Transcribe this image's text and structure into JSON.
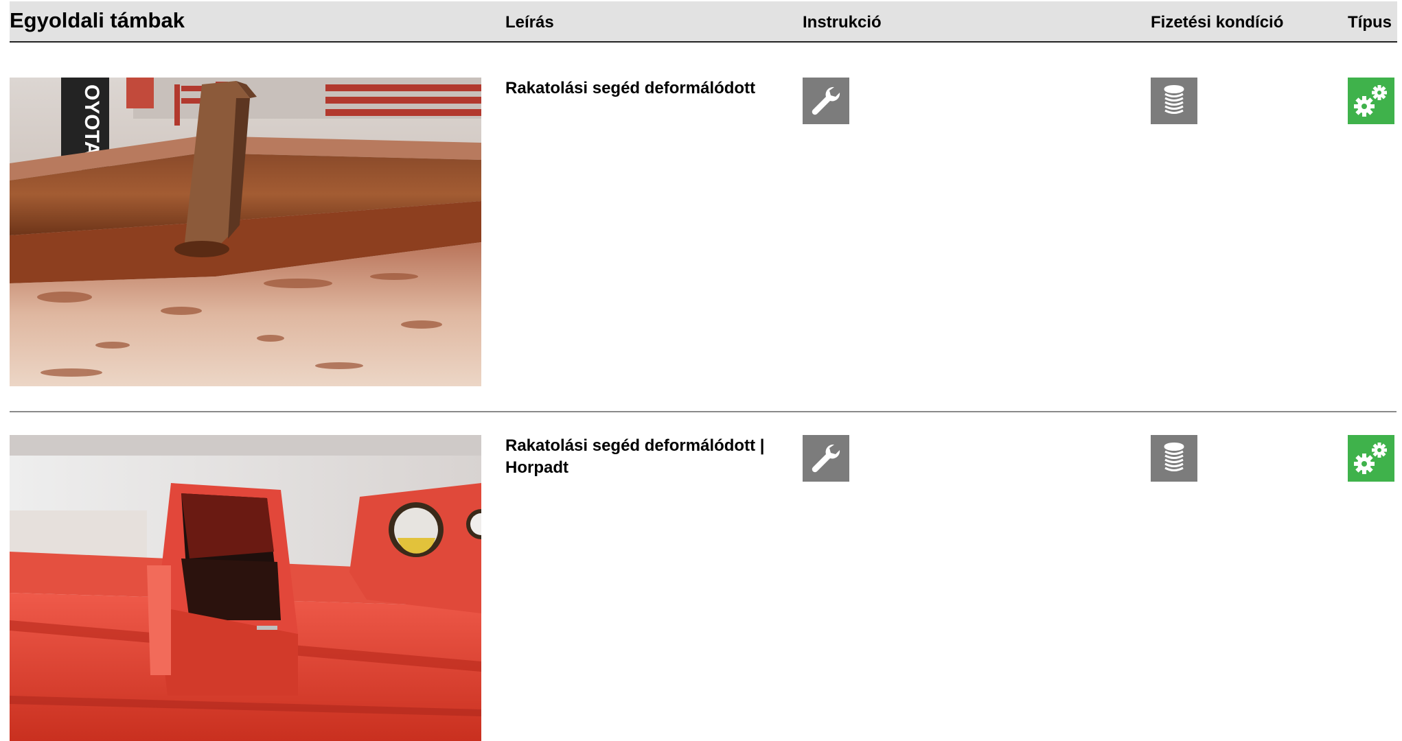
{
  "header": {
    "title": "Egyoldali támbak",
    "col_description": "Leírás",
    "col_instruction": "Instrukció",
    "col_payment": "Fizetési kondíció",
    "col_type": "Típus"
  },
  "rows": [
    {
      "description": "Rakatolási segéd deformálódott",
      "photo_text": "OYOTA",
      "instruction_icon": "wrench-icon",
      "payment_icon": "coin-stack-icon",
      "type_icon": "gears-icon"
    },
    {
      "description": "Rakatolási segéd deformálódott | Horpadt",
      "instruction_icon": "wrench-icon",
      "payment_icon": "coin-stack-icon",
      "type_icon": "gears-icon"
    }
  ],
  "colors": {
    "header_bg": "#e2e2e2",
    "icon_gray": "#7c7c7c",
    "icon_green": "#3fb24b"
  }
}
